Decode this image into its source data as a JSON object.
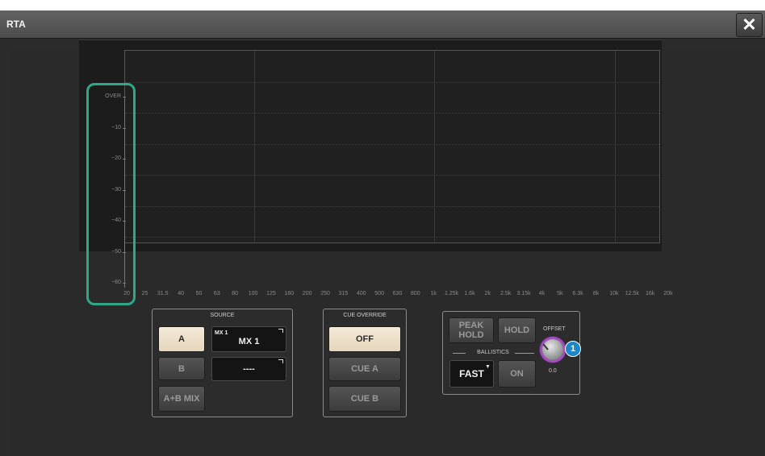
{
  "window": {
    "title": "RTA",
    "close_label": "✕"
  },
  "graph": {
    "y_labels": [
      "OVER",
      "−10",
      "−20",
      "−30",
      "−40",
      "−50",
      "−60"
    ],
    "x_labels": [
      "20",
      "25",
      "31.5",
      "40",
      "50",
      "63",
      "80",
      "100",
      "125",
      "160",
      "200",
      "250",
      "315",
      "400",
      "500",
      "630",
      "800",
      "1k",
      "1.25k",
      "1.6k",
      "2k",
      "2.5k",
      "3.15k",
      "4k",
      "5k",
      "6.3k",
      "8k",
      "10k",
      "12.5k",
      "16k",
      "20k"
    ]
  },
  "source": {
    "title": "SOURCE",
    "a_label": "A",
    "b_label": "B",
    "ab_label": "A+B MIX",
    "a_select_small": "MX 1",
    "a_select_value": "MX 1",
    "b_select_value": "----"
  },
  "cue_override": {
    "title": "CUE OVERRIDE",
    "off_label": "OFF",
    "cue_a_label": "CUE A",
    "cue_b_label": "CUE B"
  },
  "controls": {
    "peak_hold_label": "PEAK HOLD",
    "hold_label": "HOLD",
    "ballistics_label": "BALLISTICS",
    "fast_label": "FAST",
    "on_label": "ON",
    "offset_label": "OFFSET",
    "offset_value": "0.0",
    "badge": "1"
  },
  "colors": {
    "highlight": "#2fa889",
    "badge": "#1f86c8",
    "knob_ring": "#a14fbf"
  }
}
